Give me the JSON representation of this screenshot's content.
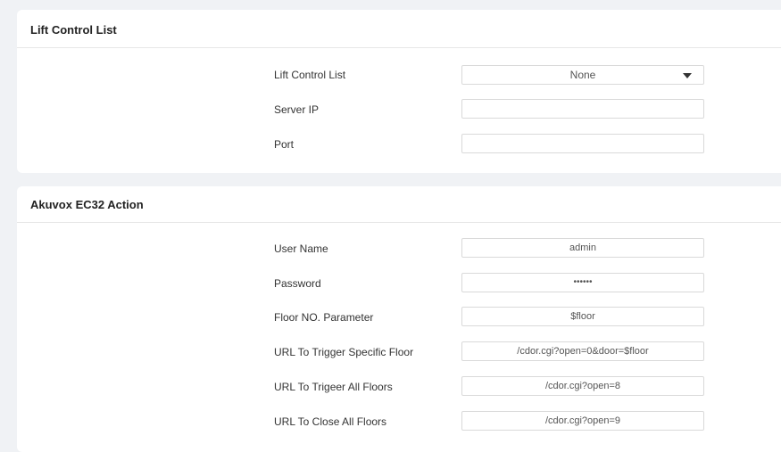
{
  "lift_control": {
    "title": "Lift Control List",
    "rows": {
      "list": {
        "label": "Lift Control List",
        "value": "None"
      },
      "server_ip": {
        "label": "Server IP",
        "value": ""
      },
      "port": {
        "label": "Port",
        "value": ""
      }
    }
  },
  "ec32_action": {
    "title": "Akuvox EC32 Action",
    "rows": {
      "user_name": {
        "label": "User Name",
        "value": "admin"
      },
      "password": {
        "label": "Password",
        "value": "••••••"
      },
      "floor_param": {
        "label": "Floor NO. Parameter",
        "value": "$floor"
      },
      "url_specific": {
        "label": "URL To Trigger Specific Floor",
        "value": "/cdor.cgi?open=0&door=$floor"
      },
      "url_all": {
        "label": "URL To Trigeer All Floors",
        "value": "/cdor.cgi?open=8"
      },
      "url_close": {
        "label": "URL To Close All Floors",
        "value": "/cdor.cgi?open=9"
      }
    }
  },
  "icons": {
    "dropdown": "chevron-down-icon"
  }
}
